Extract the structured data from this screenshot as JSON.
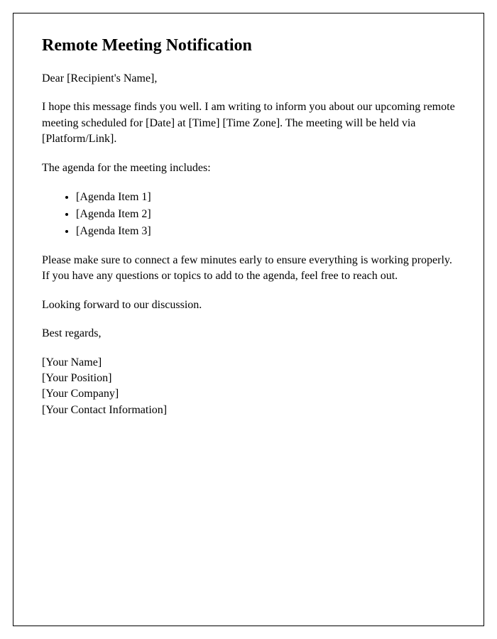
{
  "title": "Remote Meeting Notification",
  "greeting": "Dear [Recipient's Name],",
  "paragraph1": "I hope this message finds you well. I am writing to inform you about our upcoming remote meeting scheduled for [Date] at [Time] [Time Zone]. The meeting will be held via [Platform/Link].",
  "agenda_intro": "The agenda for the meeting includes:",
  "agenda_items": [
    "[Agenda Item 1]",
    "[Agenda Item 2]",
    "[Agenda Item 3]"
  ],
  "paragraph2": "Please make sure to connect a few minutes early to ensure everything is working properly. If you have any questions or topics to add to the agenda, feel free to reach out.",
  "closing1": "Looking forward to our discussion.",
  "closing2": "Best regards,",
  "signature": {
    "name": "[Your Name]",
    "position": "[Your Position]",
    "company": "[Your Company]",
    "contact": "[Your Contact Information]"
  }
}
